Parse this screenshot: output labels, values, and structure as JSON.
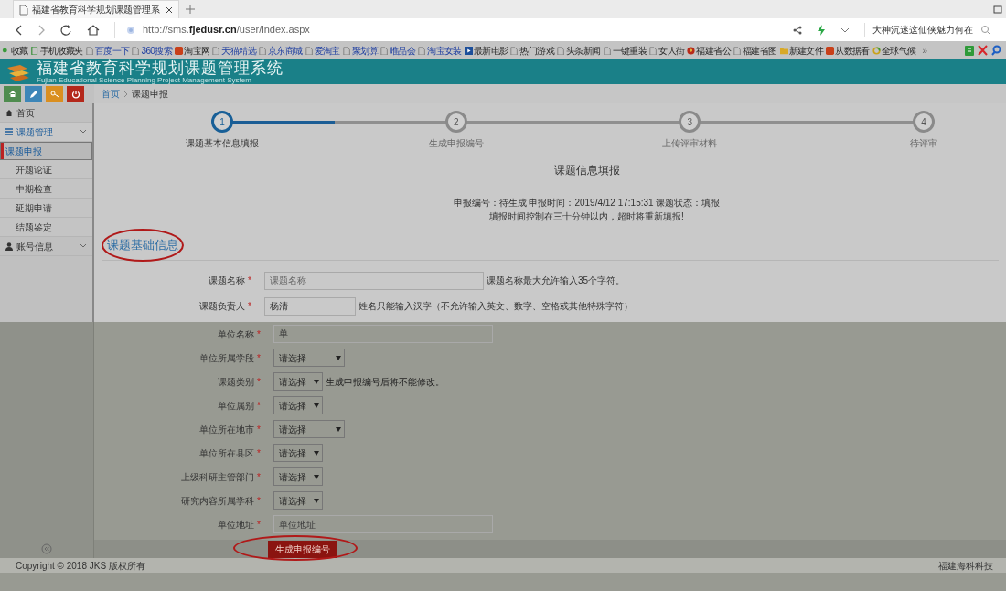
{
  "browser": {
    "tab_title": "福建省教育科学规划课题管理系",
    "url_prefix": "http://sms.",
    "url_domain": "fjedusr.cn",
    "url_path": "/user/index.aspx",
    "search_text": "大神沉迷这仙侠魅力何在"
  },
  "bookmarks": [
    {
      "label": "收藏",
      "kind": "menu"
    },
    {
      "label": "手机收藏夹",
      "kind": "phone"
    },
    {
      "label": "百度一下",
      "kind": "page"
    },
    {
      "label": "360搜索",
      "kind": "page"
    },
    {
      "label": "淘宝网",
      "kind": "app"
    },
    {
      "label": "天猫精选",
      "kind": "page"
    },
    {
      "label": "京东商城",
      "kind": "page"
    },
    {
      "label": "爱淘宝",
      "kind": "page"
    },
    {
      "label": "聚划算",
      "kind": "page"
    },
    {
      "label": "唯品会",
      "kind": "page"
    },
    {
      "label": "淘宝女装",
      "kind": "page"
    },
    {
      "label": "最新电影",
      "kind": "film"
    },
    {
      "label": "热门游戏",
      "kind": "page"
    },
    {
      "label": "头条新闻",
      "kind": "page"
    },
    {
      "label": "一键重装",
      "kind": "page"
    },
    {
      "label": "女人街",
      "kind": "page"
    },
    {
      "label": "福建省公",
      "kind": "emblem"
    },
    {
      "label": "福建省图",
      "kind": "page"
    },
    {
      "label": "新建文件",
      "kind": "folder"
    },
    {
      "label": "从数据看",
      "kind": "app"
    },
    {
      "label": "全球气候",
      "kind": "ring"
    },
    {
      "label": "»",
      "kind": "more"
    }
  ],
  "header": {
    "title": "福建省教育科学规划课题管理系统",
    "subtitle": "Fujian Educational Science Planning Project Management System"
  },
  "breadcrumb": [
    "首页",
    "课题申报"
  ],
  "sidebar": {
    "items": [
      {
        "label": "首页",
        "kind": "link"
      },
      {
        "label": "课题管理",
        "kind": "group",
        "expanded": true,
        "children": [
          {
            "label": "课题申报",
            "selected": true
          },
          {
            "label": "开题论证",
            "selected": false
          },
          {
            "label": "中期检查",
            "selected": false
          },
          {
            "label": "延期申请",
            "selected": false
          },
          {
            "label": "结题鉴定",
            "selected": false
          }
        ]
      },
      {
        "label": "账号信息",
        "kind": "group",
        "expanded": false
      }
    ]
  },
  "steps": [
    {
      "number": "1",
      "label": "课题基本信息填报",
      "selected": true
    },
    {
      "number": "2",
      "label": "生成申报编号",
      "selected": false
    },
    {
      "number": "3",
      "label": "上传评审材料",
      "selected": false
    },
    {
      "number": "4",
      "label": "待评审",
      "selected": false
    }
  ],
  "steps_progress": {
    "level": 0.16
  },
  "form": {
    "title": "课题信息填报",
    "info_lines": [
      "申报编号：待生成 申报时间：2019/4/12 17:15:31 课题状态：填报",
      "填报时间控制在三十分钟以内，超时将重新填报!"
    ],
    "section_title": "课题基础信息",
    "fields": [
      {
        "label": "课题名称",
        "required_mark": "*",
        "kind": "text",
        "placeholder": "课题名称",
        "hint": "课题名称最大允许输入35个字符。"
      },
      {
        "label": "课题负责人",
        "required_mark": "*",
        "kind": "short",
        "value": "杨清",
        "hint": "姓名只能输入汉字（不允许输入英文、数字、空格或其他特殊字符）"
      },
      {
        "label": "单位名称",
        "required_mark": "*",
        "kind": "text",
        "value": "单"
      },
      {
        "label": "单位所属学段",
        "required_mark": "*",
        "kind": "select",
        "value": "请选择"
      },
      {
        "label": "课题类别",
        "required_mark": "*",
        "kind": "compact",
        "value": "请选择",
        "hint": "生成申报编号后将不能修改。"
      },
      {
        "label": "单位属别",
        "required_mark": "*",
        "kind": "compact",
        "value": "请选择"
      },
      {
        "label": "单位所在地市",
        "required_mark": "*",
        "kind": "select",
        "value": "请选择"
      },
      {
        "label": "单位所在县区",
        "required_mark": "*",
        "kind": "compact",
        "value": "请选择"
      },
      {
        "label": "上级科研主管部门",
        "required_mark": "*",
        "kind": "compact",
        "value": "请选择"
      },
      {
        "label": "研究内容所属学科",
        "required_mark": "*",
        "kind": "compact",
        "value": "请选择"
      },
      {
        "label": "单位地址",
        "required_mark": "*",
        "kind": "text",
        "placeholder": "单位地址"
      }
    ],
    "submit": "生成申报编号"
  },
  "footer": {
    "copyright": "Copyright © 2018 JKS 版权所有",
    "company": "福建海科科技"
  }
}
